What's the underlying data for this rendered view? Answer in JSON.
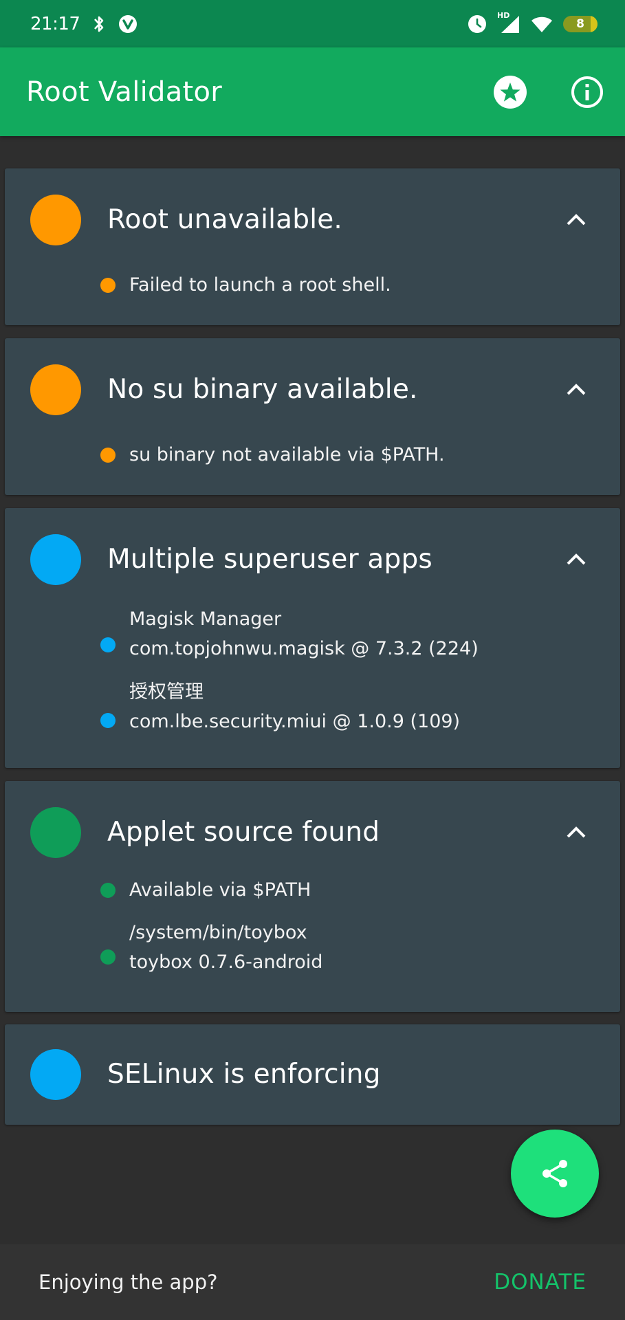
{
  "status_bar": {
    "time": "21:17",
    "battery": "8",
    "hd_label": "HD"
  },
  "app_bar": {
    "title": "Root Validator"
  },
  "cards": [
    {
      "title": "Root unavailable.",
      "color": "#ff9800",
      "items": [
        {
          "line1": "Failed to launch a root shell.",
          "line2": ""
        }
      ]
    },
    {
      "title": "No su binary available.",
      "color": "#ff9800",
      "items": [
        {
          "line1": "su binary not available via $PATH.",
          "line2": ""
        }
      ]
    },
    {
      "title": "Multiple superuser apps",
      "color": "#03a9f4",
      "items": [
        {
          "line1": "Magisk Manager",
          "line2": "com.topjohnwu.magisk @ 7.3.2 (224)"
        },
        {
          "line1": "授权管理",
          "line2": "com.lbe.security.miui @ 1.0.9 (109)"
        }
      ]
    },
    {
      "title": "Applet source found",
      "color": "#0f9d58",
      "items": [
        {
          "line1": "Available via $PATH",
          "line2": ""
        },
        {
          "line1": "/system/bin/toybox",
          "line2": "toybox 0.7.6-android"
        }
      ]
    },
    {
      "title": "SELinux is enforcing",
      "color": "#03a9f4",
      "items": []
    }
  ],
  "footer": {
    "text": "Enjoying the app?",
    "donate_label": "DONATE"
  },
  "colors": {
    "status_bar": "#0c8750",
    "app_bar": "#12aa5e",
    "card_bg": "#37474f",
    "fab": "#1ee07b",
    "donate": "#14c36a"
  }
}
